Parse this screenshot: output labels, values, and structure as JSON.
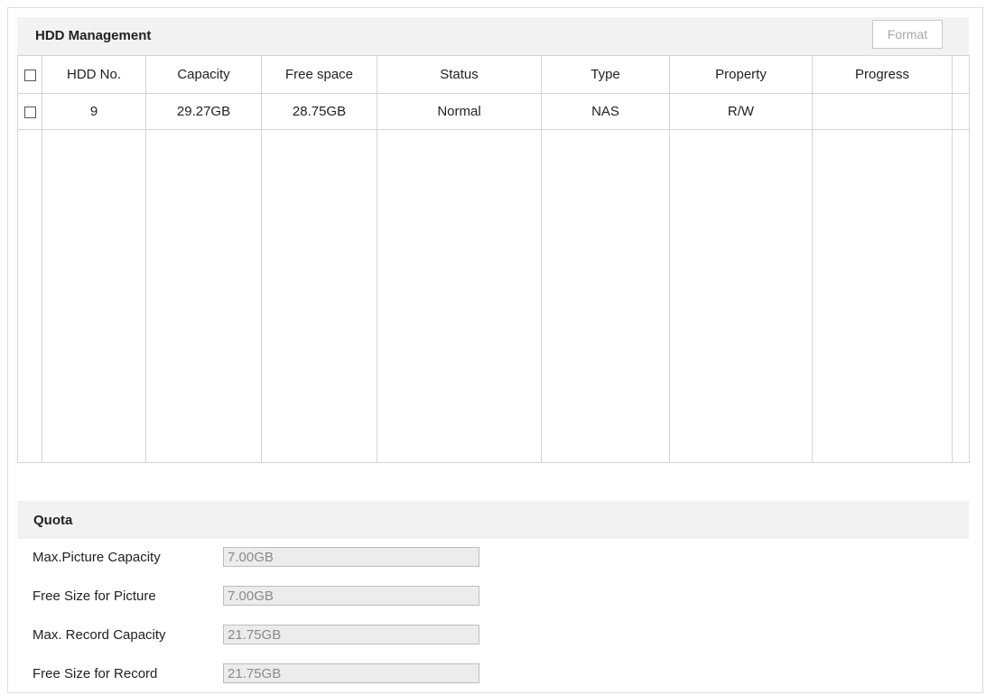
{
  "hdd": {
    "title": "HDD Management",
    "format_label": "Format",
    "columns": [
      "HDD No.",
      "Capacity",
      "Free space",
      "Status",
      "Type",
      "Property",
      "Progress"
    ],
    "rows": [
      {
        "hdd_no": "9",
        "capacity": "29.27GB",
        "free_space": "28.75GB",
        "status": "Normal",
        "type": "NAS",
        "property": "R/W",
        "progress": ""
      }
    ]
  },
  "quota": {
    "title": "Quota",
    "fields": [
      {
        "label": "Max.Picture Capacity",
        "value": "7.00GB"
      },
      {
        "label": "Free Size for Picture",
        "value": "7.00GB"
      },
      {
        "label": "Max. Record Capacity",
        "value": "21.75GB"
      },
      {
        "label": "Free Size for Record",
        "value": "21.75GB"
      }
    ]
  }
}
